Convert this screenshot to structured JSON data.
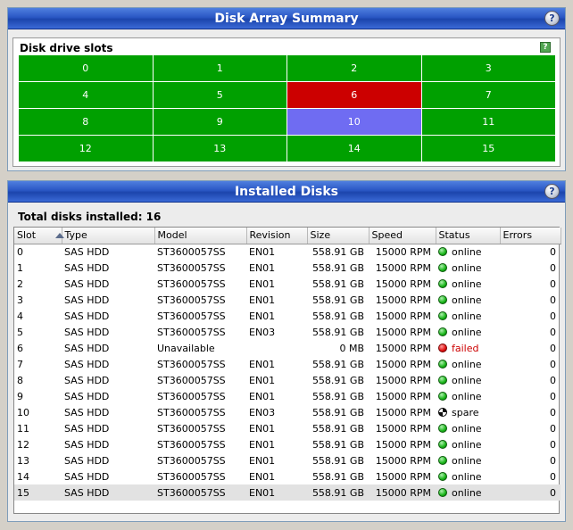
{
  "summary": {
    "title": "Disk Array Summary",
    "help": "?",
    "slots_title": "Disk drive slots",
    "slots_help": "?",
    "slots": [
      {
        "label": "0",
        "state": "online"
      },
      {
        "label": "1",
        "state": "online"
      },
      {
        "label": "2",
        "state": "online"
      },
      {
        "label": "3",
        "state": "online"
      },
      {
        "label": "4",
        "state": "online"
      },
      {
        "label": "5",
        "state": "online"
      },
      {
        "label": "6",
        "state": "failed"
      },
      {
        "label": "7",
        "state": "online"
      },
      {
        "label": "8",
        "state": "online"
      },
      {
        "label": "9",
        "state": "online"
      },
      {
        "label": "10",
        "state": "spare"
      },
      {
        "label": "11",
        "state": "online"
      },
      {
        "label": "12",
        "state": "online"
      },
      {
        "label": "13",
        "state": "online"
      },
      {
        "label": "14",
        "state": "online"
      },
      {
        "label": "15",
        "state": "online"
      }
    ]
  },
  "colors": {
    "online": "#00a000",
    "failed": "#cc0000",
    "spare": "#6f6cf2",
    "failed_text": "#cc0000"
  },
  "installed": {
    "title": "Installed Disks",
    "help": "?",
    "total_label": "Total disks installed: 16",
    "columns": [
      "Slot",
      "Type",
      "Model",
      "Revision",
      "Size",
      "Speed",
      "Status",
      "Errors"
    ],
    "selected_row": 15,
    "rows": [
      {
        "slot": "0",
        "type": "SAS HDD",
        "model": "ST3600057SS",
        "revision": "EN01",
        "size": "558.91 GB",
        "speed": "15000 RPM",
        "status": "online",
        "errors": "0"
      },
      {
        "slot": "1",
        "type": "SAS HDD",
        "model": "ST3600057SS",
        "revision": "EN01",
        "size": "558.91 GB",
        "speed": "15000 RPM",
        "status": "online",
        "errors": "0"
      },
      {
        "slot": "2",
        "type": "SAS HDD",
        "model": "ST3600057SS",
        "revision": "EN01",
        "size": "558.91 GB",
        "speed": "15000 RPM",
        "status": "online",
        "errors": "0"
      },
      {
        "slot": "3",
        "type": "SAS HDD",
        "model": "ST3600057SS",
        "revision": "EN01",
        "size": "558.91 GB",
        "speed": "15000 RPM",
        "status": "online",
        "errors": "0"
      },
      {
        "slot": "4",
        "type": "SAS HDD",
        "model": "ST3600057SS",
        "revision": "EN01",
        "size": "558.91 GB",
        "speed": "15000 RPM",
        "status": "online",
        "errors": "0"
      },
      {
        "slot": "5",
        "type": "SAS HDD",
        "model": "ST3600057SS",
        "revision": "EN03",
        "size": "558.91 GB",
        "speed": "15000 RPM",
        "status": "online",
        "errors": "0"
      },
      {
        "slot": "6",
        "type": "SAS HDD",
        "model": "Unavailable",
        "revision": "",
        "size": "0 MB",
        "speed": "15000 RPM",
        "status": "failed",
        "errors": "0"
      },
      {
        "slot": "7",
        "type": "SAS HDD",
        "model": "ST3600057SS",
        "revision": "EN01",
        "size": "558.91 GB",
        "speed": "15000 RPM",
        "status": "online",
        "errors": "0"
      },
      {
        "slot": "8",
        "type": "SAS HDD",
        "model": "ST3600057SS",
        "revision": "EN01",
        "size": "558.91 GB",
        "speed": "15000 RPM",
        "status": "online",
        "errors": "0"
      },
      {
        "slot": "9",
        "type": "SAS HDD",
        "model": "ST3600057SS",
        "revision": "EN01",
        "size": "558.91 GB",
        "speed": "15000 RPM",
        "status": "online",
        "errors": "0"
      },
      {
        "slot": "10",
        "type": "SAS HDD",
        "model": "ST3600057SS",
        "revision": "EN03",
        "size": "558.91 GB",
        "speed": "15000 RPM",
        "status": "spare",
        "errors": "0"
      },
      {
        "slot": "11",
        "type": "SAS HDD",
        "model": "ST3600057SS",
        "revision": "EN01",
        "size": "558.91 GB",
        "speed": "15000 RPM",
        "status": "online",
        "errors": "0"
      },
      {
        "slot": "12",
        "type": "SAS HDD",
        "model": "ST3600057SS",
        "revision": "EN01",
        "size": "558.91 GB",
        "speed": "15000 RPM",
        "status": "online",
        "errors": "0"
      },
      {
        "slot": "13",
        "type": "SAS HDD",
        "model": "ST3600057SS",
        "revision": "EN01",
        "size": "558.91 GB",
        "speed": "15000 RPM",
        "status": "online",
        "errors": "0"
      },
      {
        "slot": "14",
        "type": "SAS HDD",
        "model": "ST3600057SS",
        "revision": "EN01",
        "size": "558.91 GB",
        "speed": "15000 RPM",
        "status": "online",
        "errors": "0"
      },
      {
        "slot": "15",
        "type": "SAS HDD",
        "model": "ST3600057SS",
        "revision": "EN01",
        "size": "558.91 GB",
        "speed": "15000 RPM",
        "status": "online",
        "errors": "0"
      }
    ]
  }
}
